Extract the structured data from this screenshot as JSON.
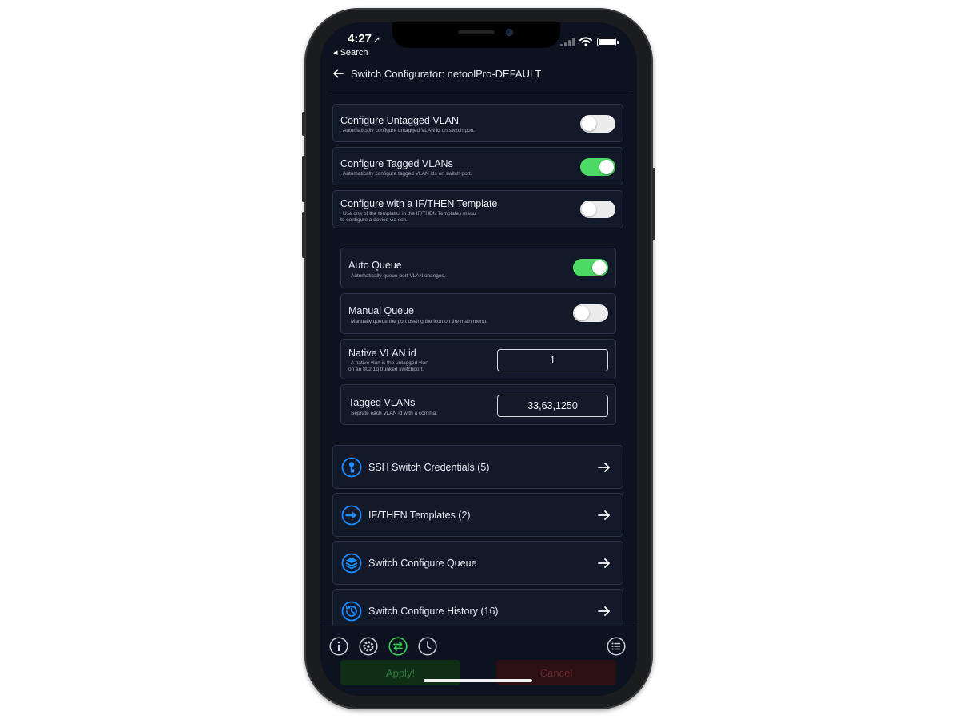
{
  "status_bar": {
    "time": "4:27",
    "time_arrow": "➚",
    "back_label": "◂ Search"
  },
  "header": {
    "title": "Switch Configurator: netoolPro-DEFAULT"
  },
  "settings": [
    {
      "title": "Configure Untagged VLAN",
      "desc": "Automatically configure untagged VLAN id on switch port.",
      "on": false
    },
    {
      "title": "Configure Tagged VLANs",
      "desc": "Automatically configure tagged VLAN ids on switch port.",
      "on": true
    },
    {
      "title": "Configure with a IF/THEN Template",
      "desc": "Use one of the templates in the IF/THEN Templates menu",
      "desc2": "to configure a device via ssh.",
      "on": false
    }
  ],
  "queue": [
    {
      "title": "Auto Queue",
      "desc": "Automatically queue port VLAN changes.",
      "on": true
    },
    {
      "title": "Manual Queue",
      "desc": "Manually queue the port useing the icon on the main menu.",
      "on": false
    }
  ],
  "vlan_fields": {
    "native": {
      "title": "Native VLAN id",
      "desc": "A native vlan is the untagged vlan",
      "desc2": "on an 802.1q trunked switchport.",
      "value": "1"
    },
    "tagged": {
      "title": "Tagged VLANs",
      "desc": "Seprate each VLAN id with a comma.",
      "value": "33,63,1250"
    }
  },
  "nav": [
    {
      "label": "SSH Switch Credentials (5)",
      "icon": "key-icon"
    },
    {
      "label": "IF/THEN Templates (2)",
      "icon": "arrow-circle-icon"
    },
    {
      "label": "Switch Configure Queue",
      "icon": "layers-icon"
    },
    {
      "label": "Switch Configure History (16)",
      "icon": "history-icon"
    }
  ],
  "bottom": {
    "apply_label": "Apply!",
    "cancel_label": "Cancel"
  },
  "colors": {
    "accent_blue": "#1e8bff",
    "toggle_on": "#4cd964",
    "tab_active": "#39d353"
  }
}
